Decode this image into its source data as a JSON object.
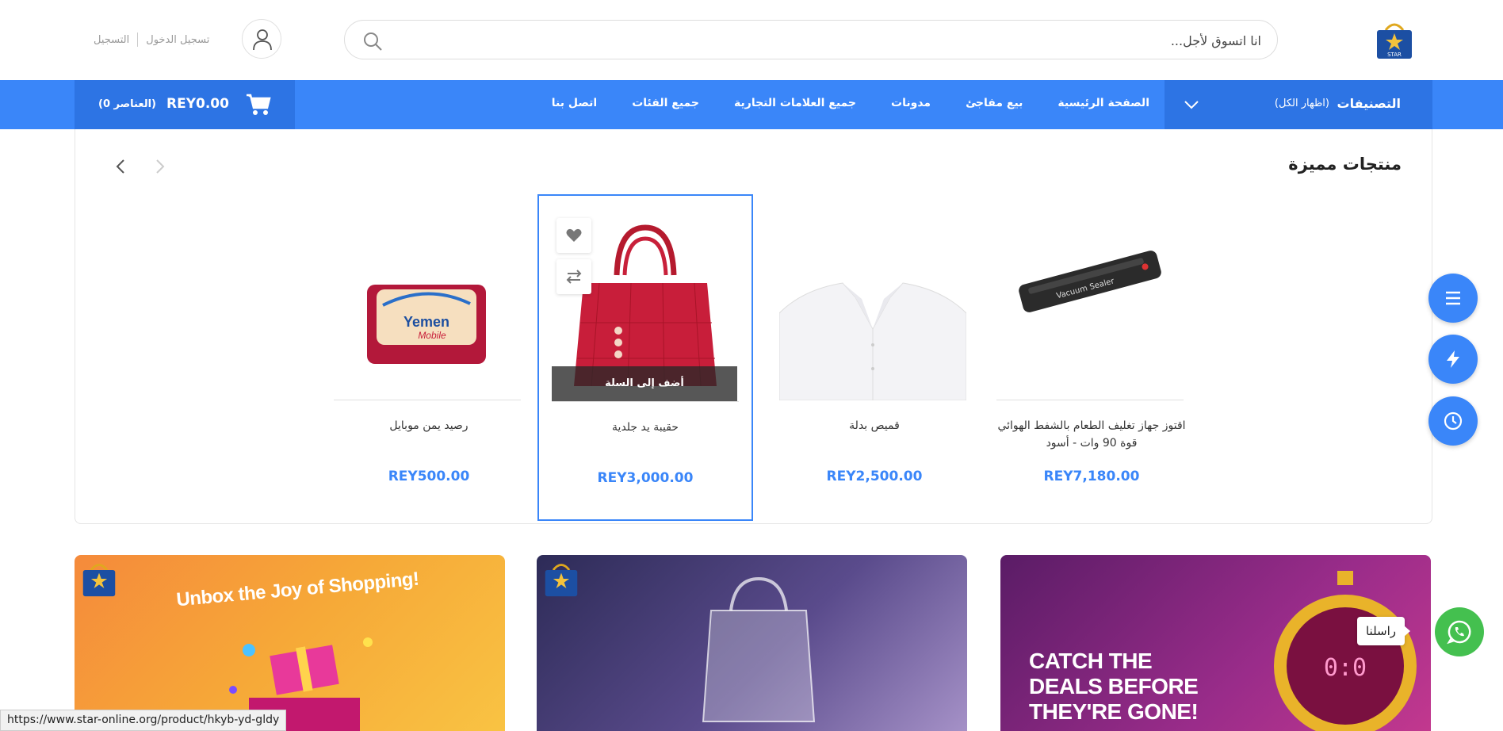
{
  "header": {
    "search_placeholder": "انا اتسوق لأجل...",
    "login_label": "تسجيل الدخول",
    "register_label": "التسجيل"
  },
  "nav": {
    "categories_label": "التصنيفات",
    "show_all_label": "(اظهار الكل)",
    "links": [
      "الصفحة الرئيسية",
      "بيع مفاجئ",
      "مدونات",
      "جميع العلامات التجارية",
      "جميع الفئات",
      "اتصل بنا"
    ],
    "cart_total": "REY0.00",
    "cart_count": "(0 العناصر)"
  },
  "featured": {
    "title": "منتجات مميزة",
    "add_to_cart_label": "أضف إلى السلة",
    "products": [
      {
        "name": "اقتوز جهاز تغليف الطعام بالشفط الهوائي قوة 90 وات - أسود",
        "price": "REY7,180.00",
        "image": "vacuum-sealer"
      },
      {
        "name": "قميص بدلة",
        "price": "REY2,500.00",
        "image": "white-shirt"
      },
      {
        "name": "حقيبة يد جلدية",
        "price": "REY3,000.00",
        "image": "red-handbag"
      },
      {
        "name": "رصيد يمن موبايل",
        "price": "REY500.00",
        "image": "yemen-mobile-card"
      }
    ]
  },
  "banners": {
    "b1_heading": "Unbox the Joy of Shopping!",
    "b3_heading": "CATCH THE DEALS BEFORE THEY'RE GONE!"
  },
  "floating": {
    "contact_tooltip": "راسلنا"
  },
  "status_bar": {
    "url": "https://www.star-online.org/product/hkyb-yd-gldy"
  },
  "colors": {
    "primary": "#3a86f9",
    "primary_dark": "#2d74e4",
    "whatsapp": "#44c04f"
  }
}
